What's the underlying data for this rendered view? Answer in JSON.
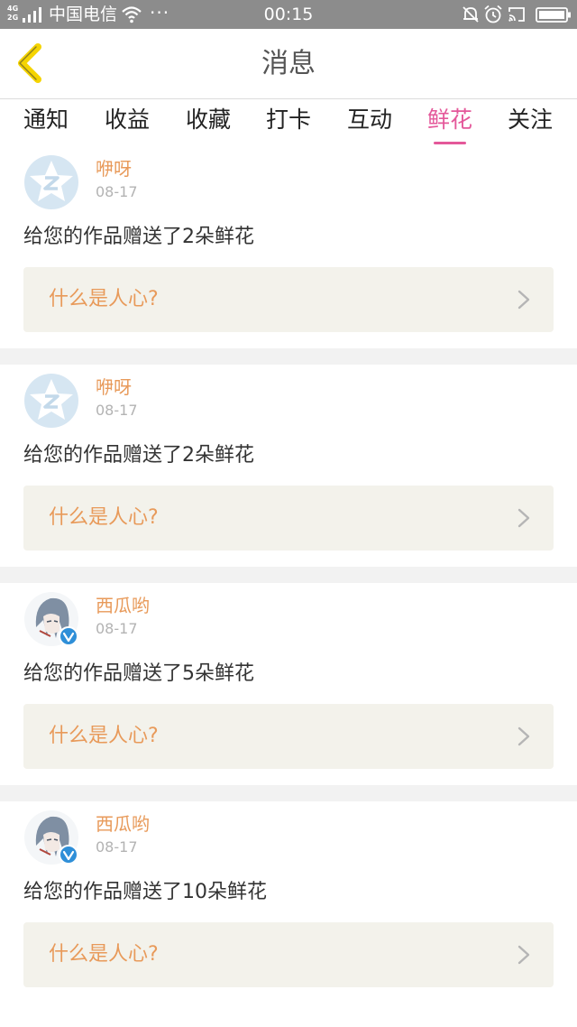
{
  "status_bar": {
    "network": "4G 2G",
    "carrier": "中国电信",
    "dots": "···",
    "time": "00:15"
  },
  "nav": {
    "title": "消息",
    "back_icon": "chevron-left-icon",
    "accent_color": "#f5d400"
  },
  "tabs": [
    {
      "label": "通知",
      "active": false
    },
    {
      "label": "收益",
      "active": false
    },
    {
      "label": "收藏",
      "active": false
    },
    {
      "label": "打卡",
      "active": false
    },
    {
      "label": "互动",
      "active": false
    },
    {
      "label": "鲜花",
      "active": true
    },
    {
      "label": "关注",
      "active": false
    }
  ],
  "colors": {
    "active_tab": "#e4589a",
    "username": "#e89a5a",
    "info_box_bg": "#f3f2eb"
  },
  "messages": [
    {
      "user": "咿呀",
      "date": "08-17",
      "text": "给您的作品赠送了2朵鲜花",
      "link_label": "什么是人心?",
      "avatar": "default-star-avatar",
      "verified": false
    },
    {
      "user": "咿呀",
      "date": "08-17",
      "text": "给您的作品赠送了2朵鲜花",
      "link_label": "什么是人心?",
      "avatar": "default-star-avatar",
      "verified": false
    },
    {
      "user": "西瓜哟",
      "date": "08-17",
      "text": "给您的作品赠送了5朵鲜花",
      "link_label": "什么是人心?",
      "avatar": "anime-character-avatar",
      "verified": true
    },
    {
      "user": "西瓜哟",
      "date": "08-17",
      "text": "给您的作品赠送了10朵鲜花",
      "link_label": "什么是人心?",
      "avatar": "anime-character-avatar",
      "verified": true
    }
  ]
}
